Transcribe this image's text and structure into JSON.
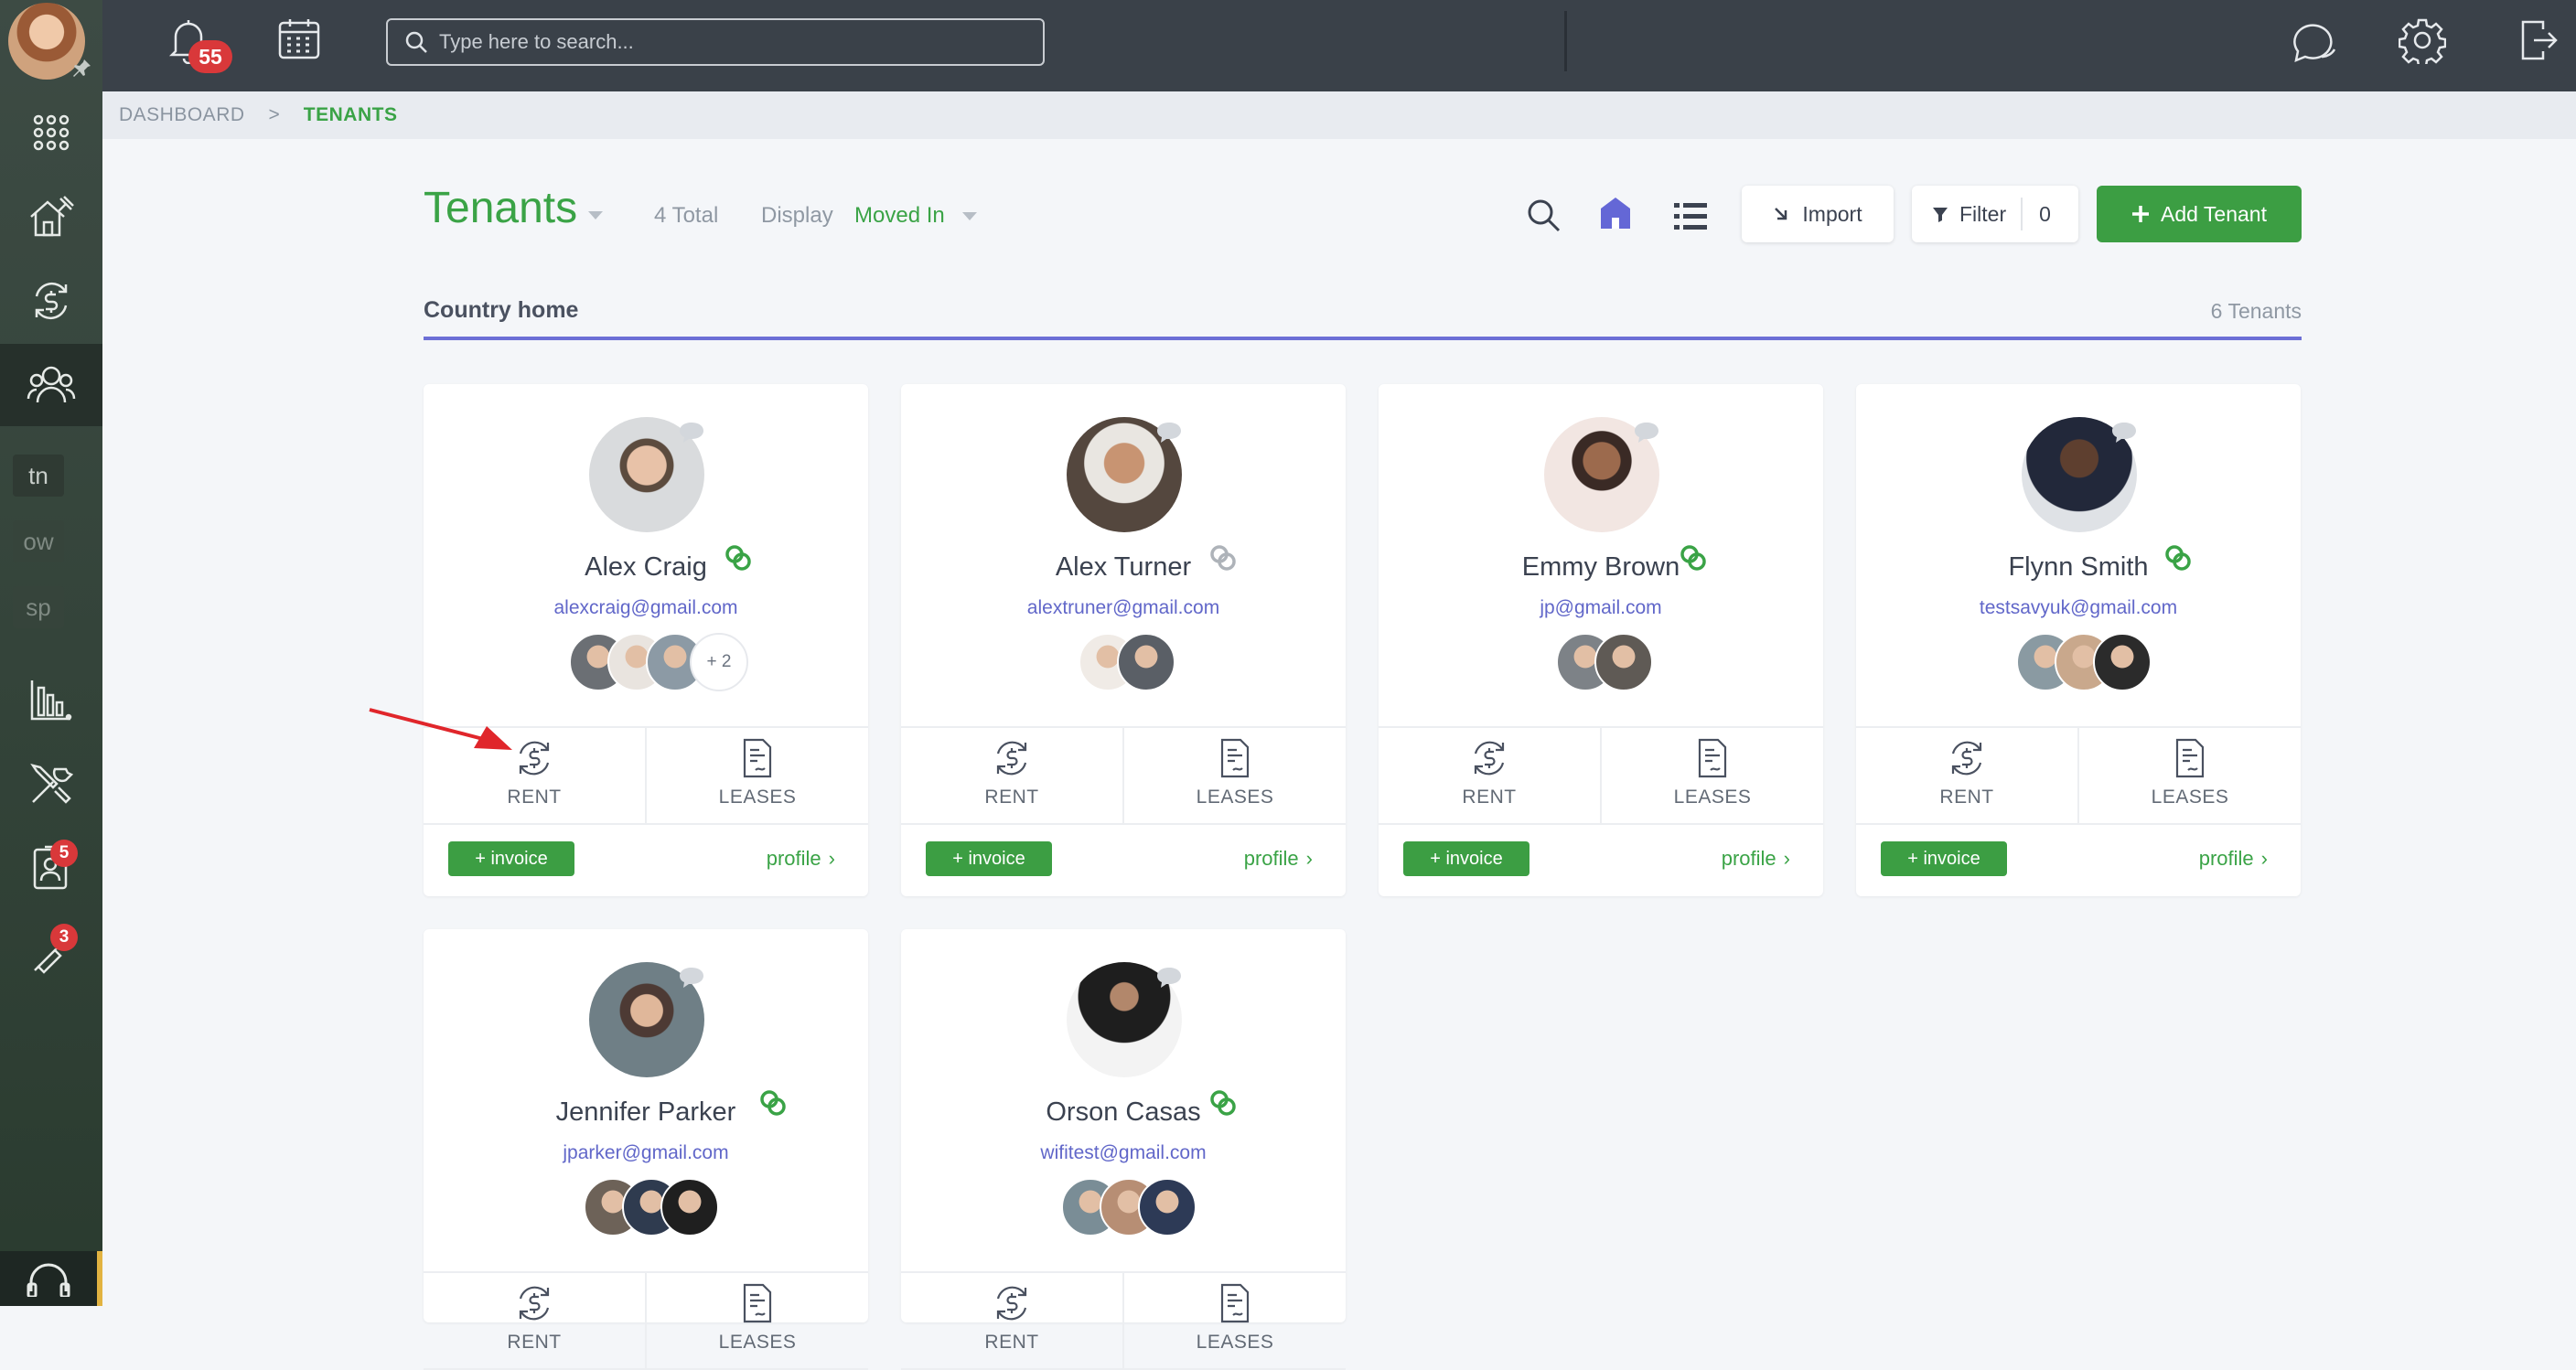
{
  "sidebar": {
    "items": [
      {
        "name": "apps",
        "icon": "grid-icon"
      },
      {
        "name": "properties",
        "icon": "house-icon"
      },
      {
        "name": "payments",
        "icon": "dollar-cycle-icon"
      },
      {
        "name": "tenants",
        "icon": "people-icon",
        "active": true
      },
      {
        "name": "tn",
        "label": "tn"
      },
      {
        "name": "ow",
        "label": "ow"
      },
      {
        "name": "sp",
        "label": "sp"
      },
      {
        "name": "reports",
        "icon": "bar-chart-icon"
      },
      {
        "name": "maintenance",
        "icon": "tools-icon"
      },
      {
        "name": "applicants",
        "icon": "id-card-icon",
        "badge": "5"
      },
      {
        "name": "tasks",
        "icon": "wrench-icon",
        "badge": "3"
      }
    ]
  },
  "topbar": {
    "notifications_count": "55",
    "search_placeholder": "Type here to search..."
  },
  "breadcrumb": {
    "root": "DASHBOARD",
    "separator": ">",
    "current": "TENANTS"
  },
  "header": {
    "title": "Tenants",
    "total": "4 Total",
    "display_label": "Display",
    "display_value": "Moved In",
    "import_label": "Import",
    "filter_label": "Filter",
    "filter_count": "0",
    "add_label": "Add Tenant"
  },
  "section": {
    "title": "Country home",
    "count": "6 Tenants"
  },
  "tenants": [
    {
      "name": "Alex Craig",
      "email": "alexcraig@gmail.com",
      "linked": true,
      "more": "+ 2"
    },
    {
      "name": "Alex Turner",
      "email": "alextruner@gmail.com",
      "linked": false
    },
    {
      "name": "Emmy Brown",
      "email": "jp@gmail.com",
      "linked": true
    },
    {
      "name": "Flynn Smith",
      "email": "testsavyuk@gmail.com",
      "linked": true
    },
    {
      "name": "Jennifer Parker",
      "email": "jparker@gmail.com",
      "linked": true
    },
    {
      "name": "Orson Casas",
      "email": "wifitest@gmail.com",
      "linked": true
    }
  ],
  "card_labels": {
    "rent": "RENT",
    "leases": "LEASES",
    "invoice": "+ invoice",
    "profile": "profile"
  },
  "colors": {
    "accent_green": "#3aa346",
    "link_blue": "#6167c9",
    "sidebar": "#34443a",
    "topbar": "#3a4149",
    "badge_red": "#d9383a"
  }
}
